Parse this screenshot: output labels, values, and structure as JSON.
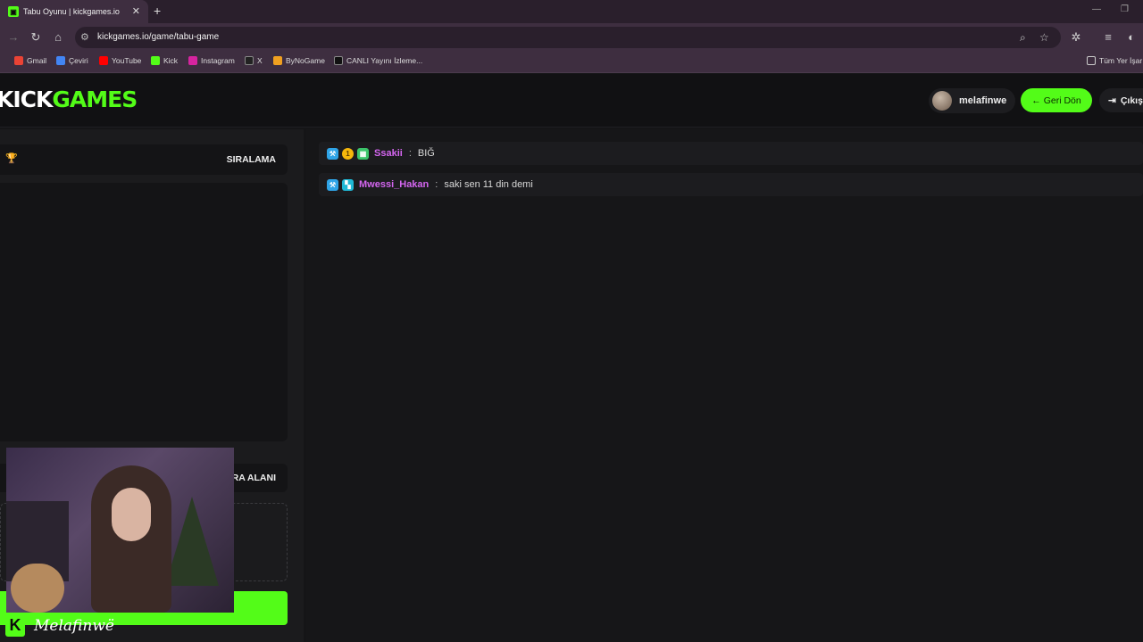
{
  "browser": {
    "tab_title": "Tabu Oyunu | kickgames.io",
    "url": "kickgames.io/game/tabu-game",
    "bookmarks": [
      "Gmail",
      "Çeviri",
      "YouTube",
      "Kick",
      "Instagram",
      "X",
      "ByNoGame",
      "CANLI Yayını İzleme...",
      "Tüm Yer İşar"
    ]
  },
  "site": {
    "logo_kick": "KICK",
    "logo_games": "GAMES",
    "username": "melafinwe",
    "back_button": "← Geri Dön",
    "exit_button": "Çıkış"
  },
  "left_panel": {
    "ranking_title": "SIRALAMA",
    "area_title": "RA ALANI"
  },
  "chat": {
    "messages": [
      {
        "user": "Ssakii",
        "text": "BIĞ"
      },
      {
        "user": "Mwessi_Hakan",
        "text": "saki sen 11 din demi"
      }
    ]
  },
  "overlay": {
    "streamer_name": "Melafinwë",
    "logo_letter": "K"
  },
  "colors": {
    "accent": "#53fc18",
    "username": "#d466f0"
  }
}
